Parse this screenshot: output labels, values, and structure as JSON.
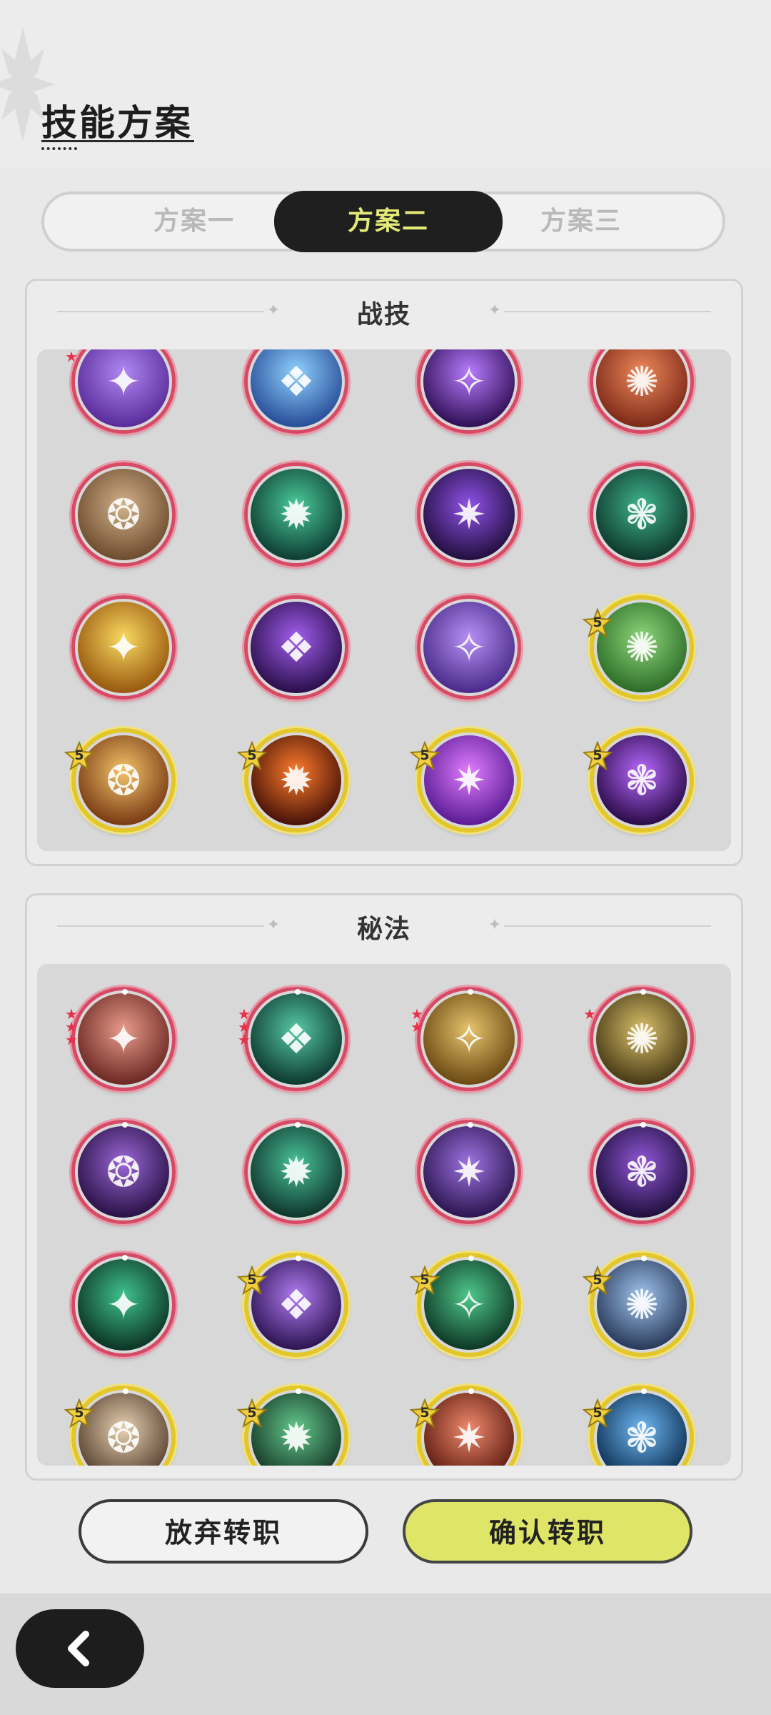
{
  "header": {
    "title": "技能方案"
  },
  "tabs": [
    {
      "label": "方案一",
      "active": false
    },
    {
      "label": "方案二",
      "active": true
    },
    {
      "label": "方案三",
      "active": false
    }
  ],
  "sections": {
    "combat": {
      "title": "战技",
      "skills": [
        {
          "icon": "purple-warrior-icon",
          "frame": "red",
          "mini_stars": 1,
          "colors": [
            "#b188f3",
            "#5a2d9b"
          ]
        },
        {
          "icon": "ice-splash-icon",
          "frame": "red",
          "mini_stars": 0,
          "colors": [
            "#8fd2ff",
            "#2a4f9a"
          ]
        },
        {
          "icon": "dark-star-icon",
          "frame": "red",
          "mini_stars": 0,
          "colors": [
            "#b87cff",
            "#321157"
          ]
        },
        {
          "icon": "fire-totem-icon",
          "frame": "red",
          "mini_stars": 0,
          "colors": [
            "#ef8a5b",
            "#7f2b1a"
          ]
        },
        {
          "icon": "rock-cards-icon",
          "frame": "red",
          "mini_stars": 0,
          "colors": [
            "#d2b28b",
            "#6e4e2f"
          ]
        },
        {
          "icon": "spirit-aura-icon",
          "frame": "red",
          "mini_stars": 0,
          "colors": [
            "#4acb9b",
            "#0f3f33"
          ]
        },
        {
          "icon": "void-vortex-icon",
          "frame": "red",
          "mini_stars": 0,
          "colors": [
            "#8f52e9",
            "#241041"
          ]
        },
        {
          "icon": "thorn-vines-icon",
          "frame": "red",
          "mini_stars": 0,
          "colors": [
            "#3fb58e",
            "#0f3a2d"
          ]
        },
        {
          "icon": "golden-cross-icon",
          "frame": "red",
          "mini_stars": 0,
          "colors": [
            "#f9da61",
            "#9a5a10"
          ]
        },
        {
          "icon": "dark-eye-icon",
          "frame": "red",
          "mini_stars": 0,
          "colors": [
            "#a25fef",
            "#2c104d"
          ]
        },
        {
          "icon": "arcane-sigil-icon",
          "frame": "red",
          "mini_stars": 0,
          "colors": [
            "#b791f5",
            "#4b2c8c"
          ]
        },
        {
          "icon": "tree-stump-icon",
          "frame": "gold",
          "badge": "5",
          "colors": [
            "#8ed77a",
            "#2f6e2a"
          ]
        },
        {
          "icon": "rock-golem-icon",
          "frame": "gold",
          "badge": "5",
          "colors": [
            "#f4c36b",
            "#7b3d15"
          ]
        },
        {
          "icon": "fireball-icon",
          "frame": "gold",
          "badge": "5",
          "colors": [
            "#ff7c2c",
            "#4a1408"
          ]
        },
        {
          "icon": "purple-burst-icon",
          "frame": "gold",
          "badge": "5",
          "colors": [
            "#e07dff",
            "#5d1d96"
          ]
        },
        {
          "icon": "shadow-diamond-icon",
          "frame": "gold",
          "badge": "5",
          "colors": [
            "#b768ff",
            "#2c0d4a"
          ]
        }
      ]
    },
    "arcane": {
      "title": "秘法",
      "skills": [
        {
          "icon": "crimson-wave-icon",
          "frame": "red",
          "mini_stars": 3,
          "colors": [
            "#e89c8a",
            "#6e2a25"
          ]
        },
        {
          "icon": "green-figure-icon",
          "frame": "red",
          "mini_stars": 3,
          "colors": [
            "#56c9a4",
            "#0e3b31"
          ]
        },
        {
          "icon": "golden-prayer-icon",
          "frame": "red",
          "mini_stars": 2,
          "colors": [
            "#e6c46d",
            "#6d4b14"
          ]
        },
        {
          "icon": "golden-rise-icon",
          "frame": "red",
          "mini_stars": 1,
          "colors": [
            "#d9c06a",
            "#4a3c17"
          ]
        },
        {
          "icon": "violet-mind-icon",
          "frame": "red",
          "mini_stars": 0,
          "colors": [
            "#9b67d6",
            "#2b1348"
          ]
        },
        {
          "icon": "green-heart-icon",
          "frame": "red",
          "mini_stars": 0,
          "colors": [
            "#49c39a",
            "#10382d"
          ]
        },
        {
          "icon": "ascend-figure-icon",
          "frame": "red",
          "mini_stars": 0,
          "colors": [
            "#9f73e2",
            "#2d1752"
          ]
        },
        {
          "icon": "shadow-arm-icon",
          "frame": "red",
          "mini_stars": 0,
          "colors": [
            "#9158d8",
            "#221040"
          ]
        },
        {
          "icon": "rune-tower-icon",
          "frame": "red",
          "mini_stars": 0,
          "colors": [
            "#3fc28c",
            "#0d3627"
          ]
        },
        {
          "icon": "violet-heart-icon",
          "frame": "gold",
          "badge": "5",
          "colors": [
            "#b07bf1",
            "#2f1655"
          ]
        },
        {
          "icon": "green-sparkle-icon",
          "frame": "gold",
          "badge": "5",
          "colors": [
            "#4fc88b",
            "#0e3a26"
          ]
        },
        {
          "icon": "blue-crystal-icon",
          "frame": "gold",
          "badge": "5",
          "colors": [
            "#9fc4ef",
            "#2b3c5c"
          ]
        },
        {
          "icon": "stone-mask-icon",
          "frame": "gold",
          "badge": "5",
          "colors": [
            "#e7d1b1",
            "#5b4433"
          ]
        },
        {
          "icon": "green-totem-icon",
          "frame": "gold",
          "badge": "5",
          "colors": [
            "#64c98d",
            "#173a28"
          ]
        },
        {
          "icon": "fire-shade-icon",
          "frame": "gold",
          "badge": "5",
          "colors": [
            "#ef8a6d",
            "#611d12"
          ]
        },
        {
          "icon": "water-orb-icon",
          "frame": "gold",
          "badge": "5",
          "colors": [
            "#6fb8f4",
            "#0f3356"
          ]
        }
      ]
    }
  },
  "buttons": {
    "abandon": "放弃转职",
    "confirm": "确认转职"
  },
  "footer": {
    "back_icon": "chevron-left-icon"
  },
  "colors": {
    "accent": "#dfe567",
    "dark": "#1f1f1f",
    "red_frame": "#d74a66",
    "gold_frame": "#e3c72a"
  }
}
